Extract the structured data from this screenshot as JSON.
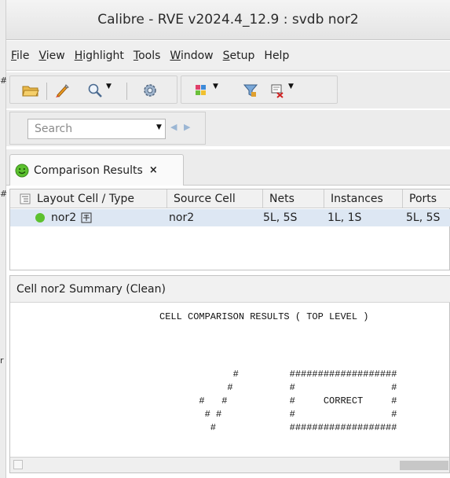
{
  "window": {
    "title": "Calibre - RVE v2024.4_12.9 : svdb nor2"
  },
  "side_strip": {
    "marks": [
      "#",
      "#",
      "r"
    ]
  },
  "menu": [
    {
      "u": "F",
      "rest": "ile"
    },
    {
      "u": "V",
      "rest": "iew"
    },
    {
      "u": "H",
      "rest": "ighlight"
    },
    {
      "u": "T",
      "rest": "ools"
    },
    {
      "u": "W",
      "rest": "indow"
    },
    {
      "u": "S",
      "rest": "etup"
    },
    {
      "u": "H",
      "rest": "elp"
    }
  ],
  "toolbar": {
    "icons": [
      "folder-open-icon",
      "highlight-pen-icon",
      "zoom-icon",
      "settings-gear-icon",
      "color-palette-icon",
      "filter-icon",
      "layout-view-icon"
    ]
  },
  "search": {
    "placeholder": "Search"
  },
  "tab": {
    "label": "Comparison Results",
    "close": "×"
  },
  "table": {
    "headers": [
      "Layout Cell / Type",
      "Source Cell",
      "Nets",
      "Instances",
      "Ports"
    ],
    "rows": [
      {
        "layout_cell": "nor2",
        "source_cell": "nor2",
        "nets": "5L, 5S",
        "instances": "1L, 1S",
        "ports": "5L, 5S",
        "status": "clean"
      }
    ]
  },
  "summary": {
    "title": "Cell nor2 Summary (Clean)",
    "heading": "CELL COMPARISON RESULTS ( TOP LEVEL )",
    "banner_line1": "             #         ###################",
    "banner_line2": "            #          #                 #",
    "banner_line3": "       #   #           #     CORRECT     #",
    "banner_line4": "        # #            #                 #",
    "banner_line5": "         #             ###################"
  },
  "colors": {
    "accent_green": "#5cc12f",
    "row_selected": "#dde7f3",
    "nav_arrow": "#9bb6d4"
  }
}
